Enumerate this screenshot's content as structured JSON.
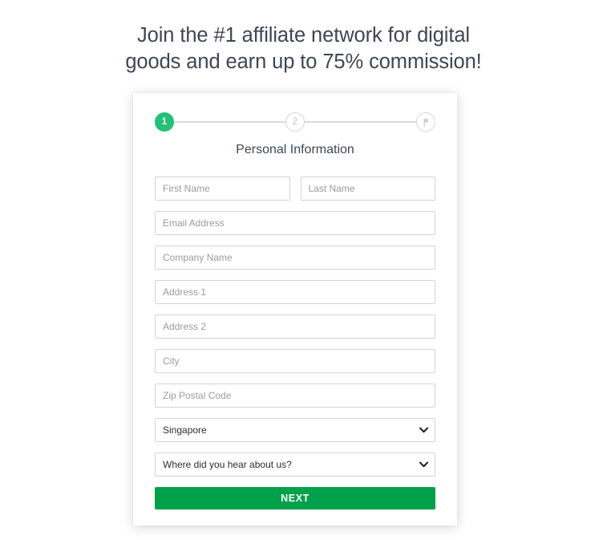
{
  "headline": {
    "line1": "Join the #1 affiliate network for digital",
    "line2": "goods and earn up to 75% commission!"
  },
  "colors": {
    "accent_green": "#22c176",
    "button_green": "#01a04a",
    "text_dark": "#3e4654",
    "placeholder": "#9b9b9b",
    "border": "#d4d4d4",
    "step_line": "#d9d9d9"
  },
  "stepper": {
    "steps": [
      {
        "label": "1",
        "state": "active",
        "icon": ""
      },
      {
        "label": "2",
        "state": "inactive",
        "icon": ""
      },
      {
        "label": "",
        "state": "inactive",
        "icon": "flag-icon"
      }
    ]
  },
  "form": {
    "title": "Personal Information",
    "fields": [
      {
        "name": "first-name",
        "placeholder": "First Name",
        "value": ""
      },
      {
        "name": "last-name",
        "placeholder": "Last Name",
        "value": ""
      },
      {
        "name": "email-address",
        "placeholder": "Email Address",
        "value": ""
      },
      {
        "name": "company-name",
        "placeholder": "Company Name",
        "value": ""
      },
      {
        "name": "address-1",
        "placeholder": "Address 1",
        "value": ""
      },
      {
        "name": "address-2",
        "placeholder": "Address 2",
        "value": ""
      },
      {
        "name": "city",
        "placeholder": "City",
        "value": ""
      },
      {
        "name": "zip-postal-code",
        "placeholder": "Zip Postal Code",
        "value": ""
      }
    ],
    "country_select": {
      "name": "country-select",
      "selected": "Singapore"
    },
    "referral_select": {
      "name": "referral-select",
      "selected": "Where did you hear about us?"
    },
    "submit_label": "NEXT"
  }
}
